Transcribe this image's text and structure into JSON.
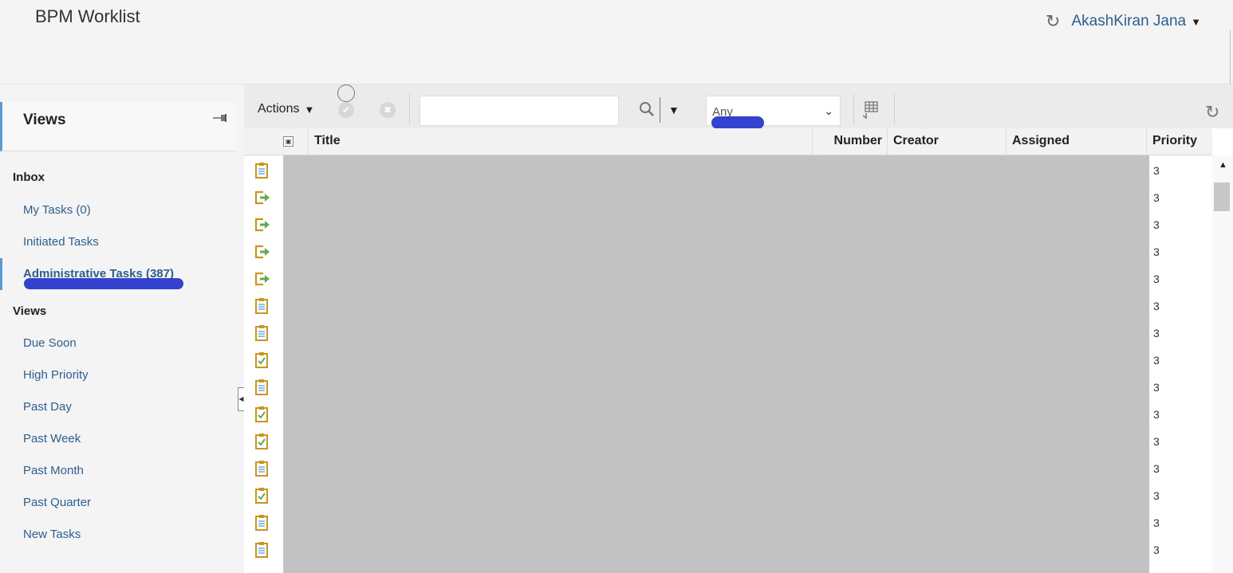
{
  "header": {
    "app_title": "BPM Worklist",
    "user_name": "AkashKiran Jana",
    "refresh_icon": "refresh-icon",
    "user_menu_icon": "caret-down-icon"
  },
  "sidebar": {
    "title": "Views",
    "pin_icon": "pin-icon",
    "inbox_label": "Inbox",
    "inbox_items": [
      {
        "label": "My Tasks (0)"
      },
      {
        "label": "Initiated Tasks"
      },
      {
        "label": "Administrative Tasks (387)",
        "active": true
      }
    ],
    "views_label": "Views",
    "view_items": [
      {
        "label": "Due Soon"
      },
      {
        "label": "High Priority"
      },
      {
        "label": "Past Day"
      },
      {
        "label": "Past Week"
      },
      {
        "label": "Past Month"
      },
      {
        "label": "Past Quarter"
      },
      {
        "label": "New Tasks"
      }
    ]
  },
  "toolbar": {
    "actions_label": "Actions",
    "search_value": "",
    "filter_value": "Any"
  },
  "table": {
    "columns": [
      "Title",
      "Number",
      "Creator",
      "Assigned",
      "Priority"
    ],
    "rows": [
      {
        "icon": "clipboard-icon",
        "priority": "3"
      },
      {
        "icon": "reassign-icon",
        "priority": "3"
      },
      {
        "icon": "reassign-icon",
        "priority": "3"
      },
      {
        "icon": "reassign-icon",
        "priority": "3"
      },
      {
        "icon": "reassign-icon",
        "priority": "3"
      },
      {
        "icon": "clipboard-icon",
        "priority": "3"
      },
      {
        "icon": "clipboard-icon",
        "priority": "3"
      },
      {
        "icon": "clipboard-check-icon",
        "priority": "3"
      },
      {
        "icon": "clipboard-icon",
        "priority": "3"
      },
      {
        "icon": "clipboard-check-icon",
        "priority": "3"
      },
      {
        "icon": "clipboard-check-icon",
        "priority": "3"
      },
      {
        "icon": "clipboard-icon",
        "priority": "3"
      },
      {
        "icon": "clipboard-check-icon",
        "priority": "3"
      },
      {
        "icon": "clipboard-icon",
        "priority": "3"
      },
      {
        "icon": "clipboard-icon",
        "priority": "3"
      }
    ]
  },
  "colors": {
    "link": "#2c5f8f",
    "accent": "#5b9bd5",
    "icon_gold": "#c8961e",
    "icon_green": "#6aa84f",
    "redaction": "#2233cc"
  }
}
